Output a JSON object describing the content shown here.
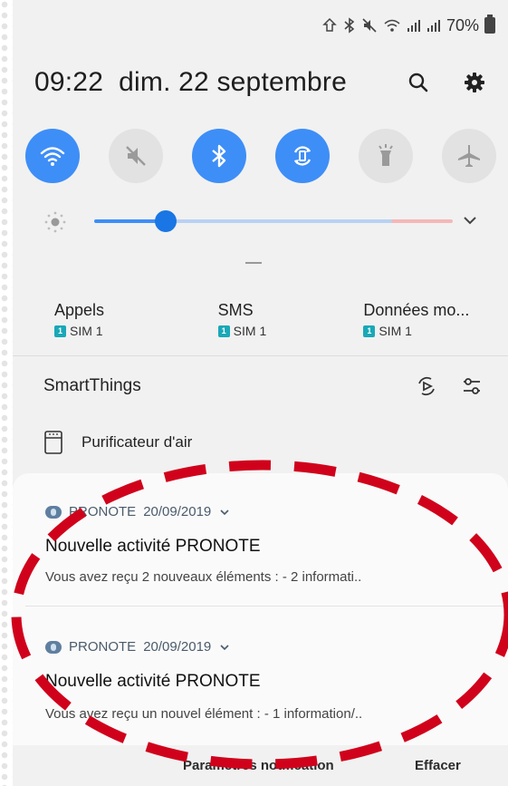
{
  "status_bar": {
    "battery_text": "70%",
    "icons": [
      "sync-icon",
      "bluetooth-icon",
      "mute-icon",
      "wifi-icon",
      "signal-icon",
      "signal-icon"
    ]
  },
  "header": {
    "time": "09:22",
    "date": "dim. 22 septembre"
  },
  "quick_toggles": [
    {
      "icon": "wifi-icon",
      "on": true
    },
    {
      "icon": "mute-icon",
      "on": false
    },
    {
      "icon": "bluetooth-icon",
      "on": true
    },
    {
      "icon": "auto-rotate-icon",
      "on": true
    },
    {
      "icon": "flashlight-icon",
      "on": false
    },
    {
      "icon": "airplane-icon",
      "on": false
    }
  ],
  "brightness": {
    "level": 0.2
  },
  "sim_tiles": [
    {
      "title": "Appels",
      "sim": "SIM 1"
    },
    {
      "title": "SMS",
      "sim": "SIM 1"
    },
    {
      "title": "Données mo...",
      "sim": "SIM 1"
    }
  ],
  "smartthings": {
    "title": "SmartThings",
    "device": "Purificateur d'air"
  },
  "notifications": [
    {
      "app": "PRONOTE",
      "date": "20/09/2019",
      "title": "Nouvelle activité PRONOTE",
      "body": "Vous avez reçu 2 nouveaux éléments :  - 2 informati.."
    },
    {
      "app": "PRONOTE",
      "date": "20/09/2019",
      "title": "Nouvelle activité PRONOTE",
      "body": "Vous avez reçu un nouvel élément :  - 1 information/.."
    }
  ],
  "bottom_bar": {
    "settings_label": "Paramètres notification",
    "clear_label": "Effacer"
  },
  "colors": {
    "accent": "#3e8ef7",
    "annotation": "#d0021b"
  }
}
